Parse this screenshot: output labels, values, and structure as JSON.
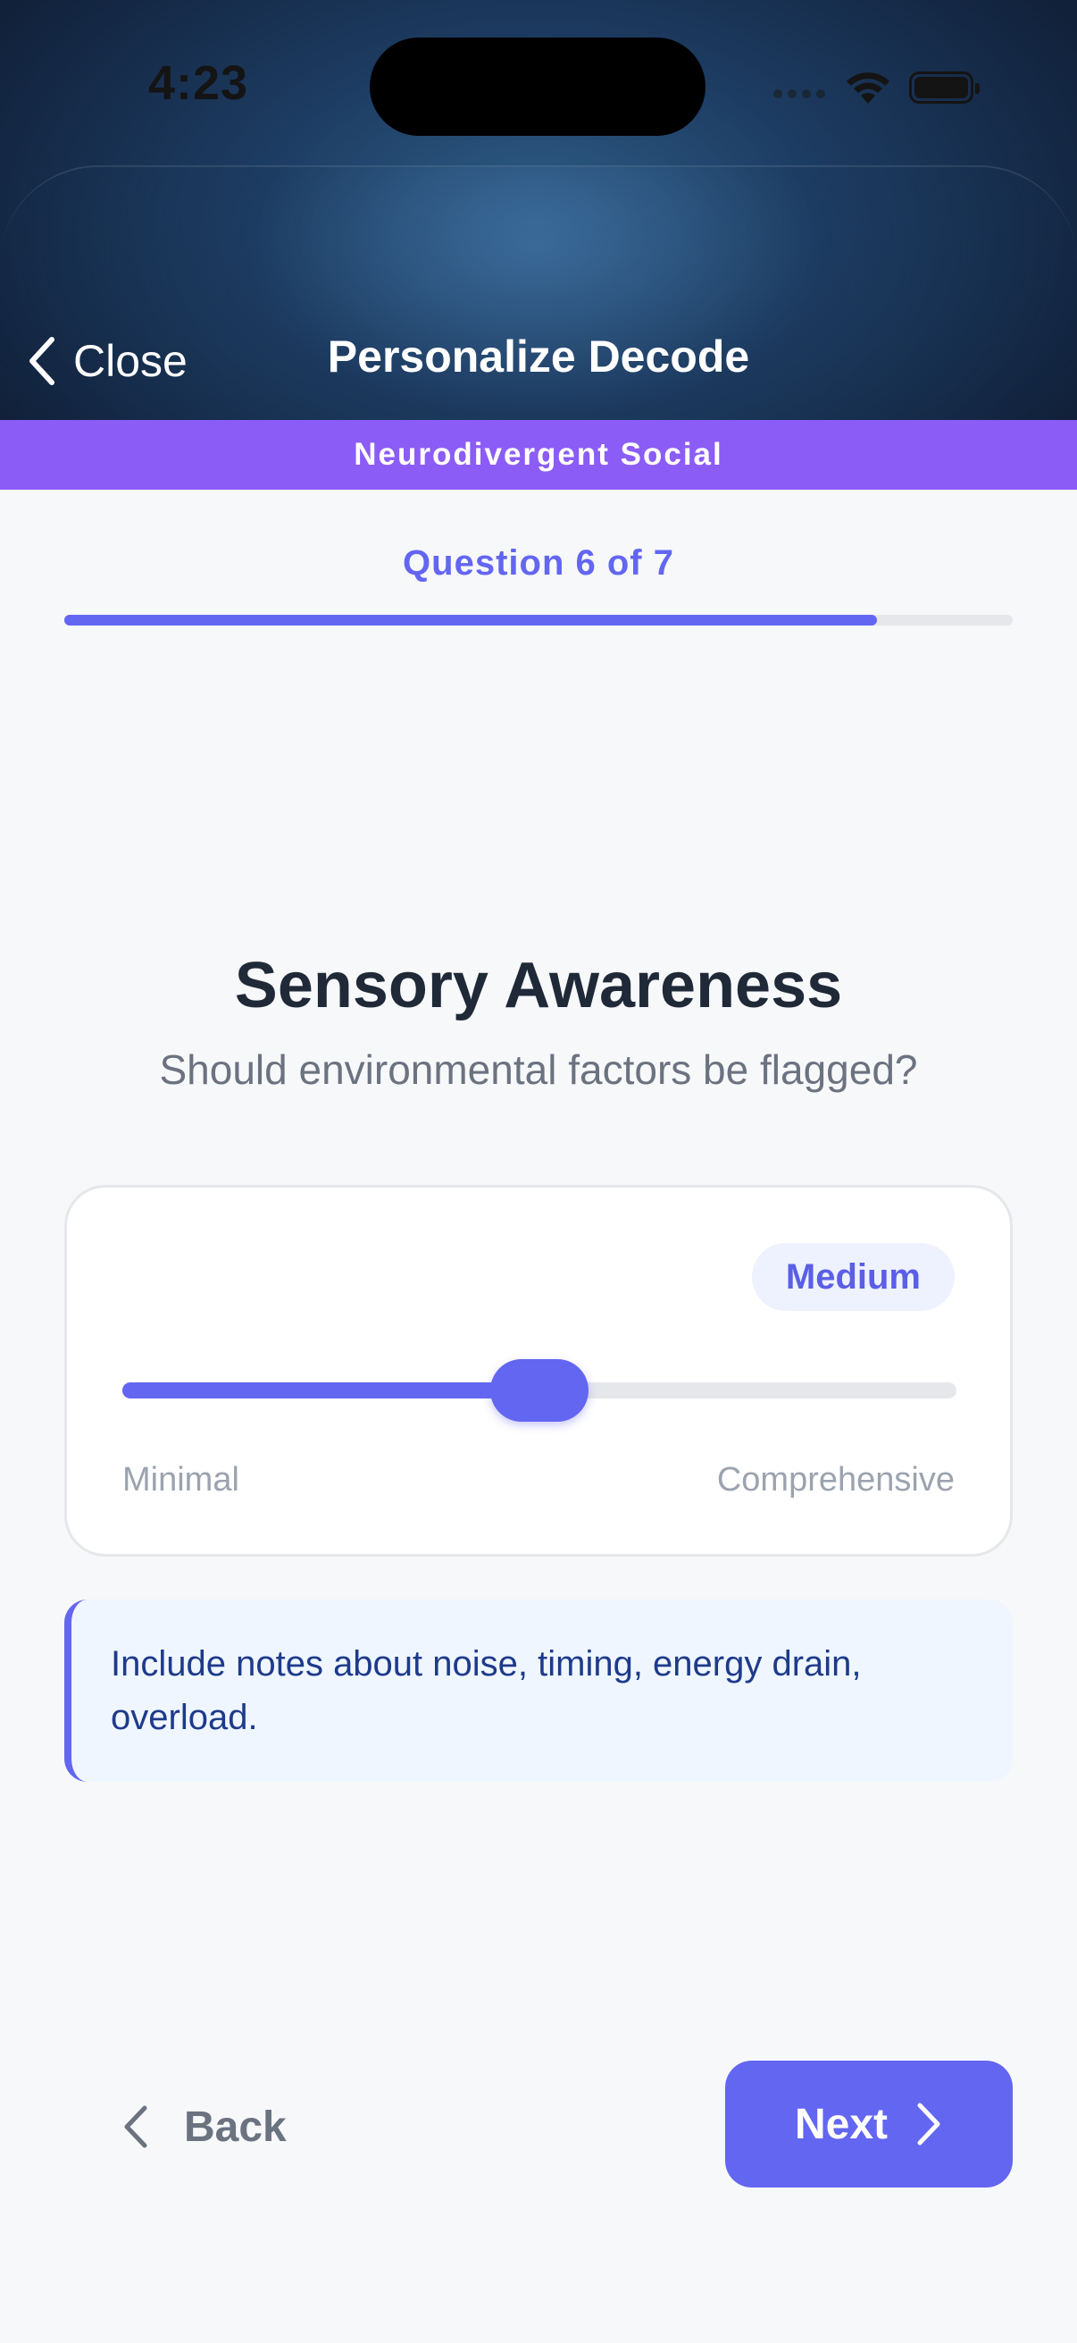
{
  "status_bar": {
    "time": "4:23"
  },
  "nav": {
    "close_label": "Close",
    "title": "Personalize Decode"
  },
  "mode_banner": "Neurodivergent Social",
  "progress": {
    "label": "Question 6 of 7",
    "current": 6,
    "total": 7,
    "fill_fraction": 0.857
  },
  "question": {
    "title": "Sensory Awareness",
    "subtitle": "Should environmental factors be flagged?"
  },
  "slider": {
    "level_label": "Medium",
    "value_fraction": 0.5,
    "min_label": "Minimal",
    "max_label": "Comprehensive"
  },
  "hint": "Include notes about noise, timing, energy drain, overload.",
  "footer": {
    "back_label": "Back",
    "next_label": "Next"
  },
  "colors": {
    "accent": "#6366f1",
    "banner": "#8b5cf6",
    "header_dark": "#11213a",
    "hint_bg": "#eff6ff"
  },
  "icons": [
    "chevron-left-icon",
    "wifi-icon",
    "battery-icon",
    "chevron-right-icon"
  ]
}
